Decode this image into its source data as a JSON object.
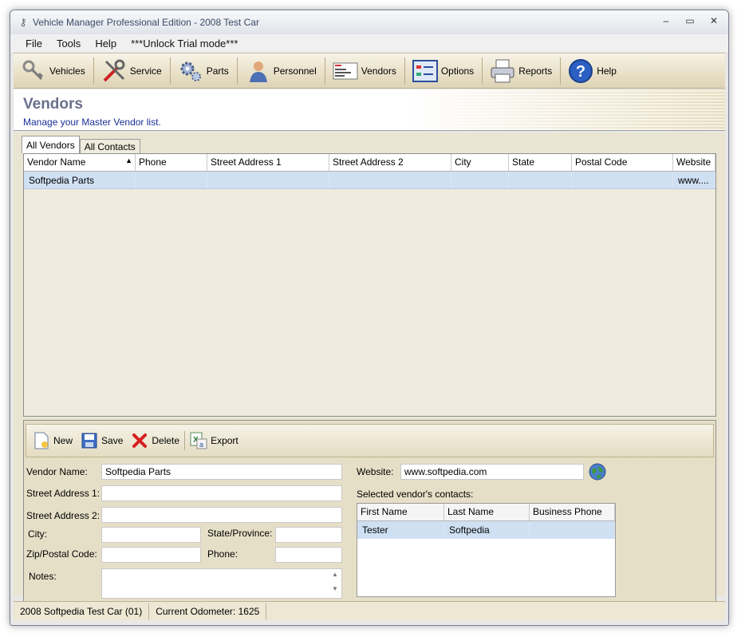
{
  "window": {
    "title": "Vehicle Manager Professional Edition - 2008 Test Car",
    "controls": [
      "–",
      "▭",
      "✕"
    ]
  },
  "menu": [
    "File",
    "Tools",
    "Help",
    "***Unlock Trial mode***"
  ],
  "toolbar": [
    {
      "label": "Vehicles",
      "icon": "keys-icon"
    },
    {
      "label": "Service",
      "icon": "tools-icon"
    },
    {
      "label": "Parts",
      "icon": "gears-icon"
    },
    {
      "label": "Personnel",
      "icon": "person-icon"
    },
    {
      "label": "Vendors",
      "icon": "card-icon"
    },
    {
      "label": "Options",
      "icon": "options-icon"
    },
    {
      "label": "Reports",
      "icon": "printer-icon"
    },
    {
      "label": "Help",
      "icon": "help-icon"
    }
  ],
  "header": {
    "title": "Vendors",
    "subtitle": "Manage your Master Vendor list."
  },
  "tabs": [
    "All Vendors",
    "All Contacts"
  ],
  "grid": {
    "columns": [
      "Vendor Name",
      "Phone",
      "Street Address 1",
      "Street Address 2",
      "City",
      "State",
      "Postal Code",
      "Website"
    ],
    "rows": [
      [
        "Softpedia Parts",
        "",
        "",
        "",
        "",
        "",
        "",
        "www...."
      ]
    ]
  },
  "detail_toolbar": [
    "New",
    "Save",
    "Delete",
    "Export"
  ],
  "form": {
    "vendor_name_label": "Vendor Name:",
    "vendor_name_value": "Softpedia Parts",
    "street1_label": "Street Address 1:",
    "street1_value": "",
    "street2_label": "Street Address 2:",
    "street2_value": "",
    "city_label": "City:",
    "city_value": "",
    "state_label": "State/Province:",
    "state_value": "",
    "zip_label": "Zip/Postal Code:",
    "zip_value": "",
    "phone_label": "Phone:",
    "phone_value": "",
    "notes_label": "Notes:",
    "notes_value": "",
    "website_label": "Website:",
    "website_value": "www.softpedia.com",
    "contacts_label": "Selected vendor's contacts:"
  },
  "contacts": {
    "columns": [
      "First Name",
      "Last Name",
      "Business Phone"
    ],
    "rows": [
      [
        "Tester",
        "Softpedia",
        ""
      ]
    ]
  },
  "status": {
    "vehicle": "2008 Softpedia Test Car (01)",
    "odometer": "Current Odometer: 1625"
  }
}
